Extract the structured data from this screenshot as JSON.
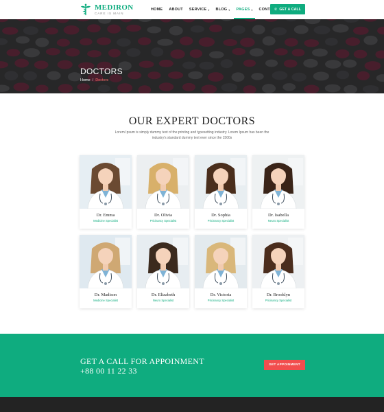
{
  "header": {
    "logo_name": "MEDIRON",
    "logo_tagline": "CARE IS MAIN",
    "nav": [
      {
        "label": "HOME",
        "dropdown": false,
        "active": false
      },
      {
        "label": "ABOUT",
        "dropdown": false,
        "active": false
      },
      {
        "label": "SERVICE",
        "dropdown": true,
        "active": false
      },
      {
        "label": "BLOG",
        "dropdown": true,
        "active": false
      },
      {
        "label": "PAGES",
        "dropdown": true,
        "active": true
      },
      {
        "label": "CONTACT",
        "dropdown": false,
        "active": false
      }
    ],
    "call_button": "GET A CALL",
    "call_icon": "phone-icon"
  },
  "hero": {
    "title": "DOCTORS",
    "breadcrumb_home": "Home",
    "breadcrumb_sep": "/",
    "breadcrumb_current": "Doctors"
  },
  "section": {
    "title": "OUR EXPERT DOCTORS",
    "description": "Lorem Ipsum is simply dummy text of the printing and typesetting industry. Lorem Ipsum has been the industry's standard dummy text ever since the 1500s"
  },
  "doctors": [
    {
      "name": "Dr. Emma",
      "specialty": "Medicine Specialist"
    },
    {
      "name": "Dr. Olivia",
      "specialty": "Pricinancy Specialist"
    },
    {
      "name": "Dr. Sophia",
      "specialty": "Pricinancy Specialist"
    },
    {
      "name": "Dr. Isabella",
      "specialty": "Neuro Specialist"
    },
    {
      "name": "Dr. Madison",
      "specialty": "Medicine Specialist"
    },
    {
      "name": "Dr. Elizabeth",
      "specialty": "Neuro Specialist"
    },
    {
      "name": "Dr. Victoria",
      "specialty": "Pricinancy Specialist"
    },
    {
      "name": "Dr. Brooklyn",
      "specialty": "Pricinancy Specialist"
    }
  ],
  "cta": {
    "title": "GET A CALL FOR APPOINMENT",
    "phone": "+88 00 11 22 33",
    "button": "GET APPOINMENT"
  },
  "colors": {
    "brand": "#0fac7f",
    "accent": "#f24e4e",
    "footer": "#232323"
  }
}
